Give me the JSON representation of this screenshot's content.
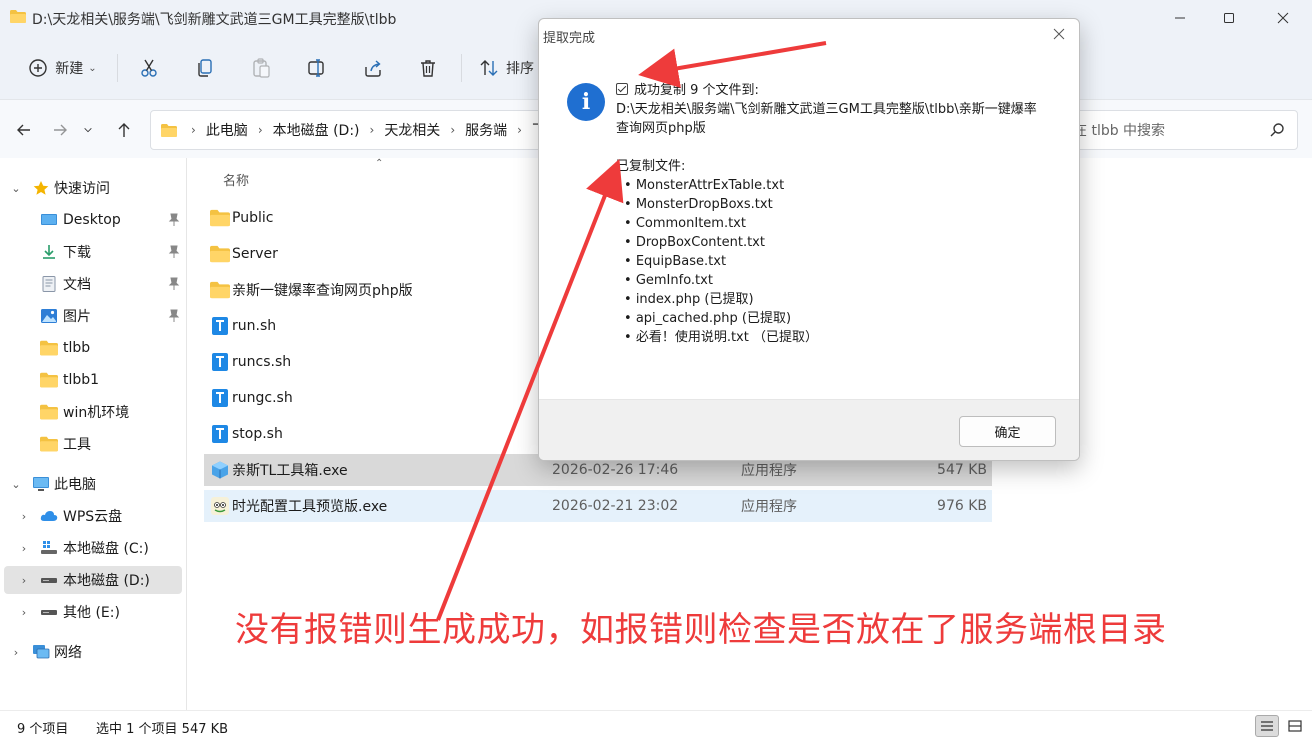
{
  "window": {
    "title": "D:\\天龙相关\\服务端\\飞剑新雕文武道三GM工具完整版\\tlbb"
  },
  "toolbar": {
    "new_label": "新建",
    "sort_label": "排序"
  },
  "address": {
    "crumbs": [
      "此电脑",
      "本地磁盘 (D:)",
      "天龙相关",
      "服务端",
      "飞"
    ],
    "search_placeholder": "在 tlbb 中搜索"
  },
  "nav": {
    "quick_access": "快速访问",
    "desktop": "Desktop",
    "downloads": "下载",
    "documents": "文档",
    "pictures": "图片",
    "tlbb": "tlbb",
    "tlbb1": "tlbb1",
    "win_env": "win机环境",
    "tools": "工具",
    "this_pc": "此电脑",
    "wps": "WPS云盘",
    "drive_c": "本地磁盘 (C:)",
    "drive_d": "本地磁盘 (D:)",
    "drive_e": "其他 (E:)",
    "network": "网络"
  },
  "filelist": {
    "name_header": "名称",
    "rows": [
      {
        "name": "Public",
        "date": "",
        "type": "",
        "size": "",
        "kind": "folder"
      },
      {
        "name": "Server",
        "date": "",
        "type": "",
        "size": "",
        "kind": "folder"
      },
      {
        "name": "亲斯一键爆率查询网页php版",
        "date": "",
        "type": "",
        "size": "",
        "kind": "folder"
      },
      {
        "name": "run.sh",
        "date": "",
        "type": "",
        "size": "",
        "kind": "sh"
      },
      {
        "name": "runcs.sh",
        "date": "",
        "type": "",
        "size": "",
        "kind": "sh"
      },
      {
        "name": "rungc.sh",
        "date": "",
        "type": "",
        "size": "",
        "kind": "sh"
      },
      {
        "name": "stop.sh",
        "date": "",
        "type": "",
        "size": "",
        "kind": "sh"
      },
      {
        "name": "亲斯TL工具箱.exe",
        "date": "2026-02-26 17:46",
        "type": "应用程序",
        "size": "547 KB",
        "kind": "exe"
      },
      {
        "name": "时光配置工具预览版.exe",
        "date": "2026-02-21 23:02",
        "type": "应用程序",
        "size": "976 KB",
        "kind": "exe2"
      }
    ]
  },
  "status": {
    "count": "9 个项目",
    "selection": "选中 1 个项目  547 KB"
  },
  "dialog": {
    "title": "提取完成",
    "success_line": "成功复制 9 个文件到:",
    "path_line1": "D:\\天龙相关\\服务端\\飞剑新雕文武道三GM工具完整版\\tlbb\\亲斯一键爆率",
    "path_line2": "查询网页php版",
    "copied_header": "已复制文件:",
    "files": [
      "MonsterAttrExTable.txt",
      "MonsterDropBoxs.txt",
      "CommonItem.txt",
      "DropBoxContent.txt",
      "EquipBase.txt",
      "GemInfo.txt",
      "index.php (已提取)",
      "api_cached.php (已提取)",
      "必看！使用说明.txt  （已提取）"
    ],
    "ok_label": "确定"
  },
  "annotation": {
    "text": "没有报错则生成成功，如报错则检查是否放在了服务端根目录",
    "color": "#ee3b3b"
  }
}
